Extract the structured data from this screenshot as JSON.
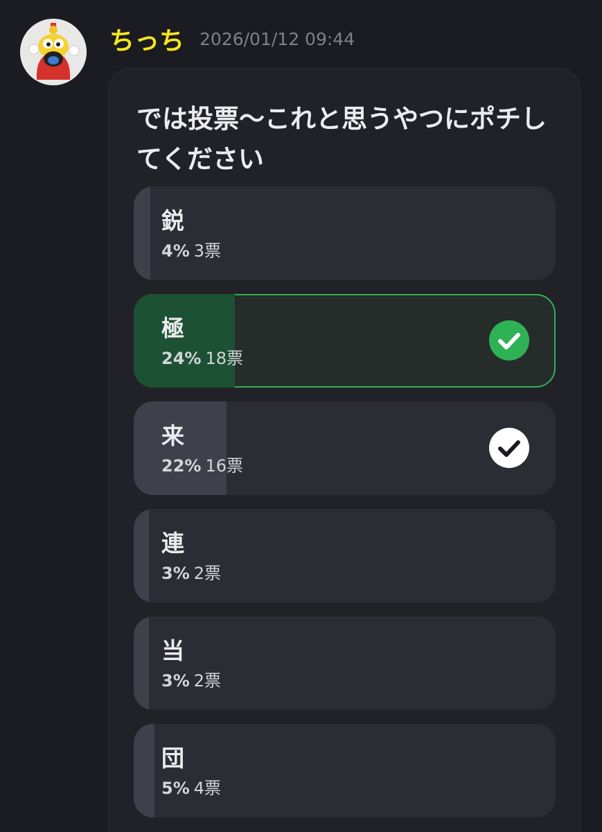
{
  "message": {
    "username": "ちっち",
    "timestamp": "2026/01/12 09:44"
  },
  "poll": {
    "question": "では投票〜これと思うやつにポチしてください",
    "options": [
      {
        "label": "鋭",
        "percent": "4%",
        "votes": "3票",
        "fraction": 0.04,
        "state": "none"
      },
      {
        "label": "極",
        "percent": "24%",
        "votes": "18票",
        "fraction": 0.24,
        "state": "selected"
      },
      {
        "label": "来",
        "percent": "22%",
        "votes": "16票",
        "fraction": 0.22,
        "state": "checked"
      },
      {
        "label": "連",
        "percent": "3%",
        "votes": "2票",
        "fraction": 0.03,
        "state": "none"
      },
      {
        "label": "当",
        "percent": "3%",
        "votes": "2票",
        "fraction": 0.03,
        "state": "none"
      },
      {
        "label": "団",
        "percent": "5%",
        "votes": "4票",
        "fraction": 0.05,
        "state": "none"
      }
    ]
  },
  "icons": {
    "avatar": "mascot-avatar-icon",
    "selected_check": "check-circle-green-icon",
    "checked": "check-circle-white-icon"
  },
  "colors": {
    "username": "#f5e61a",
    "selected_border": "#2fb255",
    "selected_fill": "#1d5133",
    "bar_fill": "#3f404b"
  }
}
